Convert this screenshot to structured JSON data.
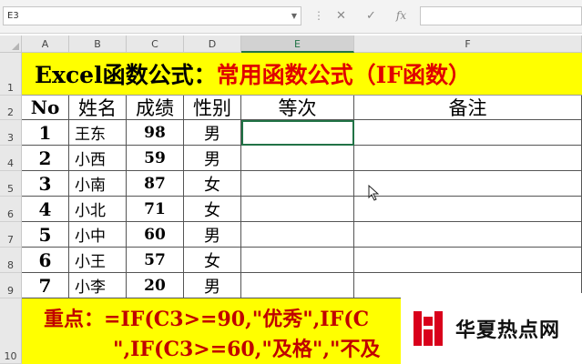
{
  "formula_bar": {
    "name_box": "E3",
    "cancel_icon": "close-icon",
    "enter_icon": "check-icon",
    "fx_label": "fx",
    "formula": ""
  },
  "columns": [
    "A",
    "B",
    "C",
    "D",
    "E",
    "F"
  ],
  "rows": [
    "1",
    "2",
    "3",
    "4",
    "5",
    "6",
    "7",
    "8",
    "9",
    "10"
  ],
  "title": {
    "part1": "Excel函数公式：",
    "part2": "常用函数公式（IF函数）"
  },
  "table": {
    "headers": [
      "No",
      "姓名",
      "成绩",
      "性别",
      "等次",
      "备注"
    ],
    "rows": [
      {
        "no": "1",
        "name": "王东",
        "score": "98",
        "sex": "男",
        "grade": "",
        "note": ""
      },
      {
        "no": "2",
        "name": "小西",
        "score": "59",
        "sex": "男",
        "grade": "",
        "note": ""
      },
      {
        "no": "3",
        "name": "小南",
        "score": "87",
        "sex": "女",
        "grade": "",
        "note": ""
      },
      {
        "no": "4",
        "name": "小北",
        "score": "71",
        "sex": "女",
        "grade": "",
        "note": ""
      },
      {
        "no": "5",
        "name": "小中",
        "score": "60",
        "sex": "男",
        "grade": "",
        "note": ""
      },
      {
        "no": "6",
        "name": "小王",
        "score": "57",
        "sex": "女",
        "grade": "",
        "note": ""
      },
      {
        "no": "7",
        "name": "小李",
        "score": "20",
        "sex": "男",
        "grade": "",
        "note": ""
      }
    ]
  },
  "note": {
    "label": "重点：",
    "line1": "=IF(C3>=90,\"优秀\",IF(C",
    "line2": "\",IF(C3>=60,\"及格\",\"不及"
  },
  "logo": {
    "text": "华夏热点网"
  },
  "colors": {
    "highlight": "#ffff00",
    "title_red": "#e00000",
    "note_red": "#c00000",
    "logo_red": "#d9001b"
  }
}
